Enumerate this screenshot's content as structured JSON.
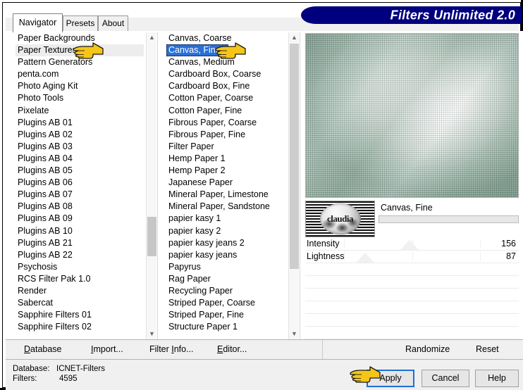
{
  "window": {
    "title": "Filters Unlimited 2.0"
  },
  "tabs": [
    {
      "label": "Navigator",
      "active": true
    },
    {
      "label": "Presets",
      "active": false
    },
    {
      "label": "About",
      "active": false
    }
  ],
  "categories": {
    "scroll_thumb_icon": "scrollbar-thumb",
    "items": [
      "Paper Backgrounds",
      "Paper Textures",
      "Pattern Generators",
      "penta.com",
      "Photo Aging Kit",
      "Photo Tools",
      "Pixelate",
      "Plugins AB 01",
      "Plugins AB 02",
      "Plugins AB 03",
      "Plugins AB 04",
      "Plugins AB 05",
      "Plugins AB 06",
      "Plugins AB 07",
      "Plugins AB 08",
      "Plugins AB 09",
      "Plugins AB 10",
      "Plugins AB 21",
      "Plugins AB 22",
      "Psychosis",
      "RCS Filter Pak 1.0",
      "Render",
      "Sabercat",
      "Sapphire Filters 01",
      "Sapphire Filters 02"
    ],
    "highlighted": "Paper Textures"
  },
  "filters": {
    "items": [
      "Canvas, Coarse",
      "Canvas, Fine",
      "Canvas, Medium",
      "Cardboard Box, Coarse",
      "Cardboard Box, Fine",
      "Cotton Paper, Coarse",
      "Cotton Paper, Fine",
      "Fibrous Paper, Coarse",
      "Fibrous Paper, Fine",
      "Filter Paper",
      "Hemp Paper 1",
      "Hemp Paper 2",
      "Japanese Paper",
      "Mineral Paper, Limestone",
      "Mineral Paper, Sandstone",
      "papier kasy 1",
      "papier kasy 2",
      "papier kasy jeans 2",
      "papier kasy jeans",
      "Papyrus",
      "Rag Paper",
      "Recycling Paper",
      "Striped Paper, Coarse",
      "Striped Paper, Fine",
      "Structure Paper 1"
    ],
    "selected": "Canvas, Fine"
  },
  "preview": {
    "filter_name": "Canvas, Fine",
    "logo_word": "claudia"
  },
  "sliders": [
    {
      "label": "Intensity",
      "value": "156",
      "pos_pct": 49
    },
    {
      "label": "Lightness",
      "value": "87",
      "pos_pct": 28
    }
  ],
  "toolbar": {
    "database": "Database",
    "import": "Import...",
    "filter_info": "Filter Info...",
    "editor": "Editor...",
    "randomize": "Randomize",
    "reset": "Reset"
  },
  "status": {
    "database_label": "Database:",
    "database_value": "ICNET-Filters",
    "filters_label": "Filters:",
    "filters_value": "4595"
  },
  "buttons": {
    "apply": "Apply",
    "cancel": "Cancel",
    "help": "Help"
  },
  "colors": {
    "title_banner": "#00007e",
    "selection": "#2a6fd6",
    "focus_border": "#1e6fd9",
    "chrome": "#f0f0f0",
    "hand_cursor": "#f5c518"
  }
}
